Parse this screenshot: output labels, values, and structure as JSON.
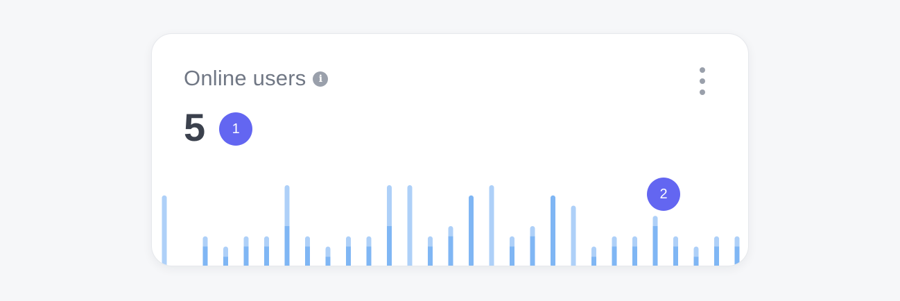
{
  "widget": {
    "title": "Online users",
    "info_icon": "info-icon",
    "info_glyph": "i",
    "menu_icon": "kebab-menu-icon",
    "value": "5",
    "badge_1": "1",
    "badge_2": "2"
  },
  "colors": {
    "bar_light": "#aed0f8",
    "bar_dark": "#7fb6f4",
    "badge": "#6366f1",
    "title": "#707784",
    "value": "#3b414d"
  },
  "chart_data": {
    "type": "bar",
    "note_stacked": true,
    "series": [
      {
        "values": [
          0,
          0,
          1,
          0.5,
          1,
          1,
          2,
          1,
          0.5,
          1,
          1,
          2,
          0,
          1,
          1.5,
          3.5,
          0,
          1,
          1.5,
          3.5,
          0,
          0.5,
          1,
          1,
          2,
          1,
          0.5,
          1,
          1
        ]
      },
      {
        "values": [
          3.5,
          0,
          0.5,
          0.5,
          0.5,
          0.5,
          2,
          0.5,
          0.5,
          0.5,
          0.5,
          2,
          4,
          0.5,
          0.5,
          0,
          4,
          0.5,
          0.5,
          0,
          3,
          0.5,
          0.5,
          0.5,
          0.5,
          0.5,
          0.5,
          0.5,
          0.5
        ]
      }
    ],
    "ylim": [
      0,
      4
    ],
    "grid": false,
    "legend": "none"
  }
}
